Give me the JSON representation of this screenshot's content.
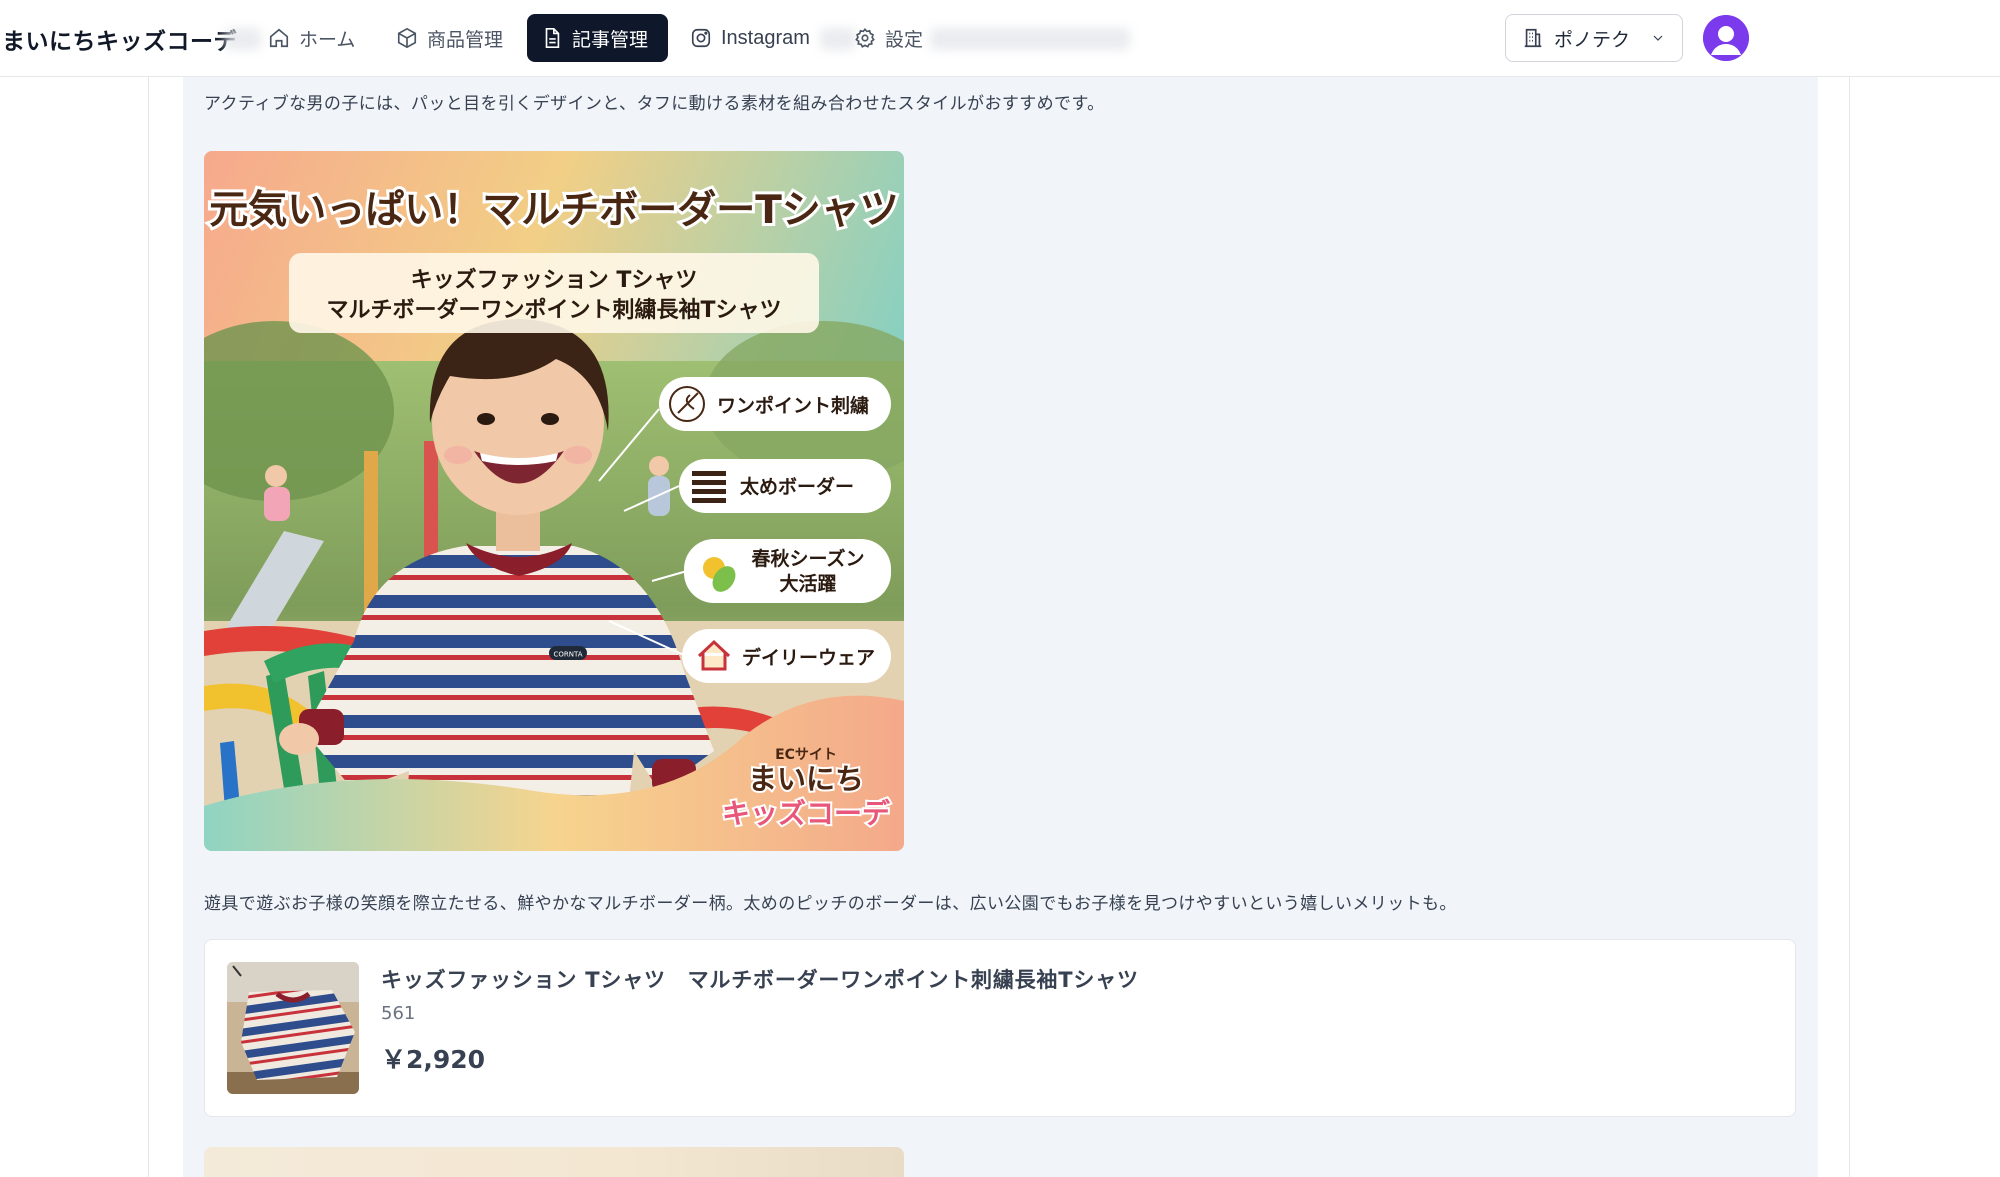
{
  "header": {
    "brand": "まいにちキッズコーデ",
    "nav": [
      {
        "label": "ホーム",
        "icon": "home-icon"
      },
      {
        "label": "商品管理",
        "icon": "box-icon"
      },
      {
        "label": "記事管理",
        "icon": "document-icon",
        "active": true
      },
      {
        "label": "Instagram",
        "icon": "instagram-icon"
      },
      {
        "label": "設定",
        "icon": "gear-icon"
      }
    ],
    "org_selector": "ポノテク"
  },
  "article": {
    "intro": "アクティブな男の子には、パッと目を引くデザインと、タフに動ける素材を組み合わせたスタイルがおすすめです。",
    "hero": {
      "headline": "元気いっぱい！マルチボーダーTシャツ",
      "sub_line1": "キッズファッション Tシャツ",
      "sub_line2": "マルチボーダーワンポイント刺繍長袖Tシャツ",
      "badges": [
        "ワンポイント刺繍",
        "太めボーダー",
        "春秋シーズン",
        "大活躍",
        "デイリーウェア"
      ],
      "logo_small": "ECサイト",
      "logo_line1": "まいにち",
      "logo_line2": "キッズコーデ",
      "shirt_tag": "CORNTA"
    },
    "body": "遊具で遊ぶお子様の笑顔を際立たせる、鮮やかなマルチボーダー柄。太めのピッチのボーダーは、広い公園でもお子様を見つけやすいという嬉しいメリットも。",
    "product": {
      "title": "キッズファッション Tシャツ　マルチボーダーワンポイント刺繍長袖Tシャツ",
      "count": "561",
      "price": "￥2,920"
    }
  },
  "colors": {
    "nav_active_bg": "#0f172a",
    "content_bg": "#f1f4f8",
    "avatar": "#7c3aed",
    "headline": "#4a2712"
  }
}
